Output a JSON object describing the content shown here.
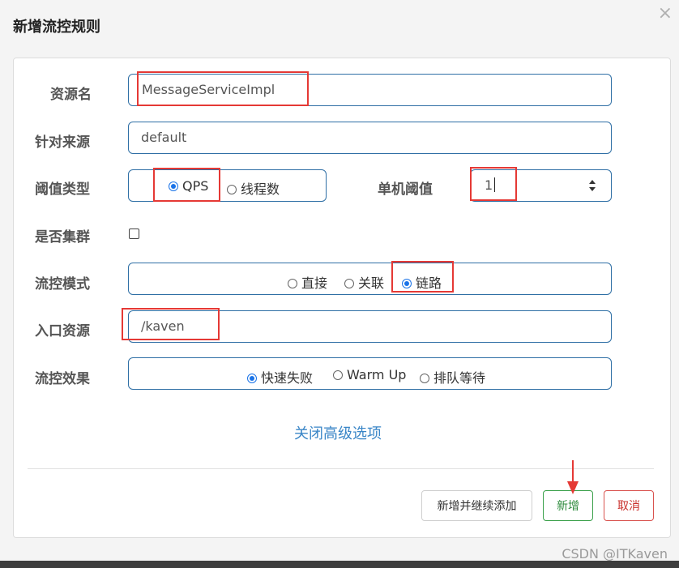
{
  "dialog": {
    "title": "新增流控规则",
    "close_icon": "close-icon"
  },
  "form": {
    "resource_label": "资源名",
    "resource_value": "MessageServiceImpl",
    "origin_label": "针对来源",
    "origin_value": "default",
    "threshold_type_label": "阈值类型",
    "threshold_type_options": [
      "QPS",
      "线程数"
    ],
    "threshold_type_selected": "QPS",
    "single_threshold_label": "单机阈值",
    "single_threshold_value": "1",
    "cluster_label": "是否集群",
    "cluster_checked": false,
    "mode_label": "流控模式",
    "mode_options": [
      "直接",
      "关联",
      "链路"
    ],
    "mode_selected": "链路",
    "entry_label": "入口资源",
    "entry_value": "/kaven",
    "effect_label": "流控效果",
    "effect_options": [
      "快速失败",
      "Warm Up",
      "排队等待"
    ],
    "effect_selected": "快速失败",
    "advanced_link": "关闭高级选项"
  },
  "buttons": {
    "add_continue": "新增并继续添加",
    "add": "新增",
    "cancel": "取消"
  },
  "watermark": "CSDN @ITKaven",
  "colors": {
    "annotation_red": "#e53935",
    "accent_blue": "#1a73e8",
    "ok_green": "#3aa04a",
    "cancel_red": "#d9534f"
  }
}
